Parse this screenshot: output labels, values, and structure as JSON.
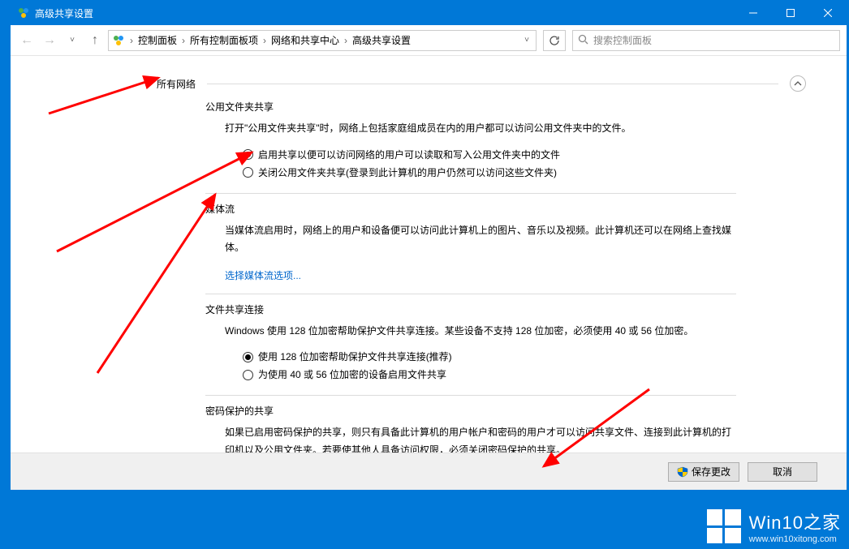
{
  "window": {
    "title": "高级共享设置"
  },
  "nav": {
    "breadcrumbs": [
      "控制面板",
      "所有控制面板项",
      "网络和共享中心",
      "高级共享设置"
    ],
    "search_placeholder": "搜索控制面板"
  },
  "section": {
    "all_networks": "所有网络"
  },
  "public_sharing": {
    "heading": "公用文件夹共享",
    "desc": "打开\"公用文件夹共享\"时，网络上包括家庭组成员在内的用户都可以访问公用文件夹中的文件。",
    "opt_enable": "启用共享以便可以访问网络的用户可以读取和写入公用文件夹中的文件",
    "opt_disable": "关闭公用文件夹共享(登录到此计算机的用户仍然可以访问这些文件夹)"
  },
  "media": {
    "heading": "媒体流",
    "desc": "当媒体流启用时，网络上的用户和设备便可以访问此计算机上的图片、音乐以及视频。此计算机还可以在网络上查找媒体。",
    "link": "选择媒体流选项..."
  },
  "file_conn": {
    "heading": "文件共享连接",
    "desc": "Windows 使用 128 位加密帮助保护文件共享连接。某些设备不支持 128 位加密，必须使用 40 或 56 位加密。",
    "opt_128": "使用 128 位加密帮助保护文件共享连接(推荐)",
    "opt_40": "为使用 40 或 56 位加密的设备启用文件共享"
  },
  "password": {
    "heading": "密码保护的共享",
    "desc": "如果已启用密码保护的共享，则只有具备此计算机的用户帐户和密码的用户才可以访问共享文件、连接到此计算机的打印机以及公用文件夹。若要使其他人具备访问权限，必须关闭密码保护的共享。"
  },
  "footer": {
    "save": "保存更改",
    "cancel": "取消"
  },
  "watermark": {
    "brand_en": "Win10",
    "brand_zh": "之家",
    "url": "www.win10xitong.com"
  }
}
